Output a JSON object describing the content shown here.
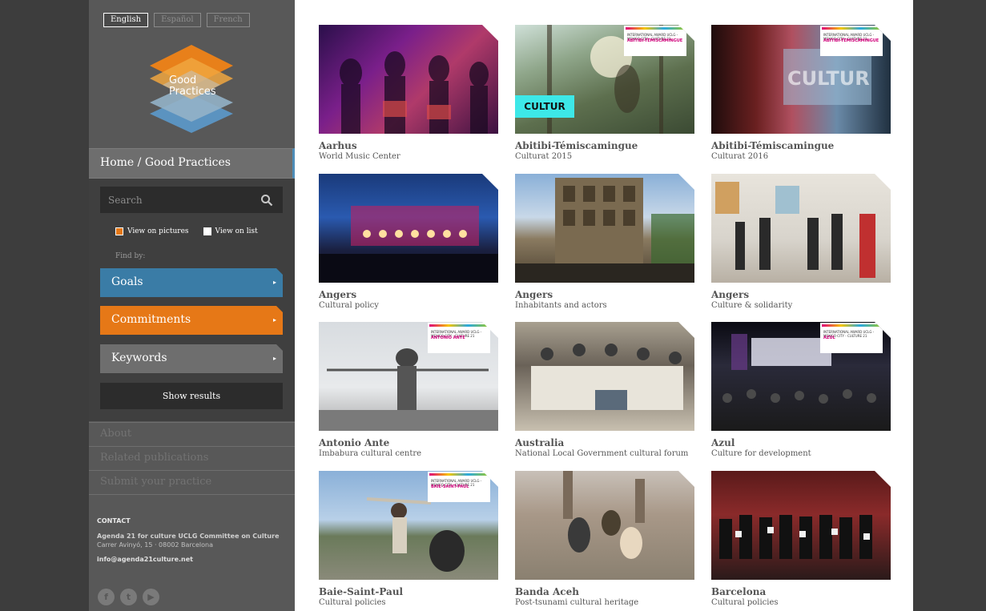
{
  "languages": [
    {
      "label": "English",
      "active": true
    },
    {
      "label": "Español",
      "active": false
    },
    {
      "label": "French",
      "active": false
    }
  ],
  "logo": {
    "line1": "Good",
    "line2": "Practices"
  },
  "breadcrumb": "Home / Good Practices",
  "search": {
    "placeholder": "Search",
    "value": ""
  },
  "view_options": [
    {
      "label": "View on pictures",
      "checked": true
    },
    {
      "label": "View on list",
      "checked": false
    }
  ],
  "find_by_label": "Find by:",
  "filters": [
    {
      "label": "Goals",
      "color": "#3a7ca6"
    },
    {
      "label": "Commitments",
      "color": "#e67817"
    },
    {
      "label": "Keywords",
      "color": "#6e6e6e"
    }
  ],
  "show_results_label": "Show results",
  "menu_links": [
    "About",
    "Related publications",
    "Submit your practice"
  ],
  "contact": {
    "heading": "CONTACT",
    "org": "Agenda 21 for culture UCLG Committee on Culture",
    "address": "Carrer Avinyó, 15 · 08002 Barcelona",
    "email": "info@agenda21culture.net"
  },
  "social_icons": [
    "facebook-icon",
    "twitter-icon",
    "youtube-icon"
  ],
  "cards": [
    {
      "title": "Aarhus",
      "subtitle": "World Music Center"
    },
    {
      "title": "Abitibi-Témiscamingue",
      "subtitle": "Culturat 2015",
      "badge": "ABITIBI-TÉMISCAMINGUE",
      "tag": "CULTUR"
    },
    {
      "title": "Abitibi-Témiscamingue",
      "subtitle": "Culturat 2016",
      "badge": "ABITIBI-TÉMISCAMINGUE"
    },
    {
      "title": "Angers",
      "subtitle": "Cultural policy"
    },
    {
      "title": "Angers",
      "subtitle": "Inhabitants and actors"
    },
    {
      "title": "Angers",
      "subtitle": "Culture & solidarity"
    },
    {
      "title": "Antonio Ante",
      "subtitle": "Imbabura cultural centre",
      "badge": "ANTONIO ANTE"
    },
    {
      "title": "Australia",
      "subtitle": "National Local Government cultural forum"
    },
    {
      "title": "Azul",
      "subtitle": "Culture for development",
      "badge": "AZUL"
    },
    {
      "title": "Baie-Saint-Paul",
      "subtitle": "Cultural policies",
      "badge": "BAIE-SAINT-PAUL"
    },
    {
      "title": "Banda Aceh",
      "subtitle": "Post-tsunami cultural heritage"
    },
    {
      "title": "Barcelona",
      "subtitle": "Cultural policies"
    }
  ],
  "badge_caption": "INTERNATIONAL AWARD UCLG - MEXICO CITY - CULTURE 21",
  "colors": {
    "accent_blue": "#3a7ca6",
    "accent_orange": "#e67817",
    "sidebar": "#585858"
  }
}
